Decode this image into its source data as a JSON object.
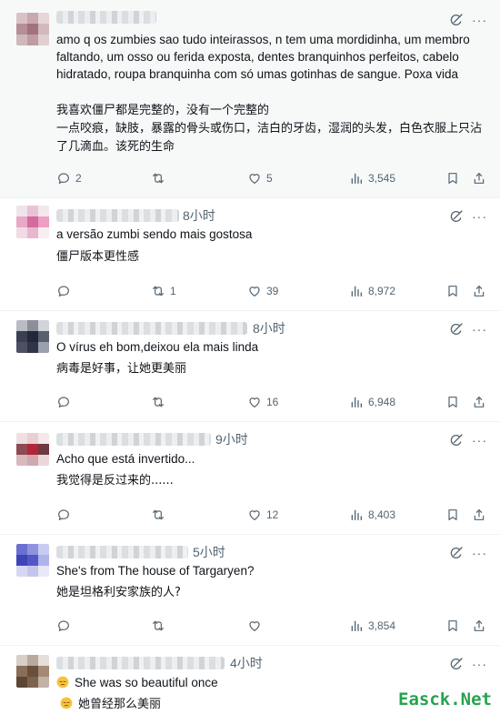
{
  "posts": [
    {
      "time": "",
      "text_original": "amo q os zumbies sao tudo inteirassos, n tem uma mordidinha, um membro faltando, um osso ou ferida exposta, dentes branquinhos perfeitos, cabelo hidratado, roupa branquinha com só umas gotinhas de sangue. Poxa vida",
      "text_translation": "我喜欢僵尸都是完整的，没有一个完整的\n一点咬痕，缺肢，暴露的骨头或伤口，洁白的牙齿，湿润的头发，白色衣服上只沾了几滴血。该死的生命",
      "replies": "2",
      "reposts": "",
      "likes": "5",
      "views": "3,545"
    },
    {
      "time": "8小时",
      "text_original": "a versão zumbi sendo mais gostosa",
      "text_translation": "僵尸版本更性感",
      "replies": "",
      "reposts": "1",
      "likes": "39",
      "views": "8,972"
    },
    {
      "time": "8小时",
      "text_original": "O vírus eh bom,deixou ela mais linda",
      "text_translation": "病毒是好事，让她更美丽",
      "replies": "",
      "reposts": "",
      "likes": "16",
      "views": "6,948"
    },
    {
      "time": "9小时",
      "text_original": "Acho que está invertido...",
      "text_translation": "我觉得是反过来的......",
      "replies": "",
      "reposts": "",
      "likes": "12",
      "views": "8,403"
    },
    {
      "time": "5小时",
      "text_original": "She's from The house of Targaryen?",
      "text_translation": "她是坦格利安家族的人?",
      "replies": "",
      "reposts": "",
      "likes": "",
      "views": "3,854"
    },
    {
      "time": "4小时",
      "text_original": "She was so beautiful once",
      "text_translation": "她曾经那么美丽"
    }
  ],
  "icons": {
    "reply": "reply-icon",
    "repost": "repost-icon",
    "like": "heart-icon",
    "views": "views-icon",
    "bookmark": "bookmark-icon",
    "share": "share-icon",
    "grok": "grok-icon",
    "emoji": "pensive-face-emoji"
  },
  "colors": {
    "text": "#0f1419",
    "muted": "#536471",
    "divider": "#eff3f4",
    "highlight_bg": "#f7f9f9"
  },
  "watermark": "Easck.Net"
}
